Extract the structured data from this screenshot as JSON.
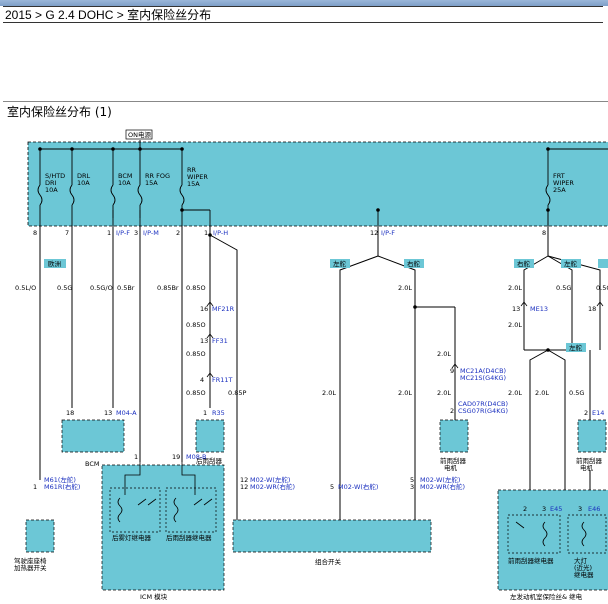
{
  "breadcrumb": "2015 > G 2.4 DOHC > 室内保险丝分布",
  "section_title": "室内保险丝分布 (1)",
  "on_label": "ON电源",
  "fuses": [
    {
      "label": "S/HTD\nDRI\n10A"
    },
    {
      "label": "DRL\n10A"
    },
    {
      "label": "BCM\n10A"
    },
    {
      "label": "RR FOG\n15A"
    },
    {
      "label": "RR\nWIPER\n15A"
    },
    {
      "label": "FRT\nWIPER\n25A"
    }
  ],
  "pins": [
    "8",
    "7",
    "1",
    "I/P-F",
    "3",
    "I/P-M",
    "2",
    "1",
    "I/P-H",
    "12",
    "I/P-F",
    "8"
  ],
  "tags": {
    "europe": "欧洲",
    "lhd": "左舵",
    "rhd": "右舵",
    "lhd2": "左舵",
    "rhd2": "右舵",
    "lhd3": "左舵",
    "lhd4": "左舵"
  },
  "wires": {
    "w1": "0.5L/O",
    "w2": "0.5G",
    "w3": "0.5G/O",
    "w4": "0.5Br",
    "w5": "0.85Br",
    "w6": "0.85O",
    "w7": "0.85O",
    "w8": "0.85O",
    "w9": "0.85O",
    "w10": "0.85P",
    "w11": "2.0L",
    "w12": "2.0L",
    "w13": "2.0L",
    "w14": "2.0L",
    "w15": "2.0L",
    "w16": "2.0L",
    "w17": "2.0L",
    "w18": "0.5G",
    "w19": "0.5G",
    "w20": "2.0L",
    "w21": "2.0L",
    "w22": "0.5G"
  },
  "connectors": {
    "mf21r": "MF21R",
    "ff31": "FF31",
    "fr11t": "FR11T",
    "me13": "ME13",
    "mc21": "MC21A(D4CB)",
    "mc21s": "MC21S(G4KG)",
    "cad07": "CAD07R(D4CB)",
    "csg07": "CSG07R(G4KG)",
    "m04a": "M04-A",
    "r35": "R35",
    "e14": "E14",
    "m08b": "M08-B",
    "m61": "M61(左舵)",
    "m61r": "M61R(右舵)",
    "m02l": "M02-W(左舵)",
    "m02r": "M02-WR(右舵)",
    "m02": "M02-W(右舵)",
    "m02l2": "M02-W(左舵)",
    "m02r2": "M02-WR(右舵)",
    "e45": "E45",
    "e46": "E46"
  },
  "pin_nums": {
    "p16": "16",
    "p13": "13",
    "p4": "4",
    "p9": "9",
    "p2": "2",
    "p18": "18",
    "p13b": "13",
    "p1": "1",
    "p1b": "1",
    "p19": "19",
    "p1c": "1",
    "p12": "12",
    "p12b": "12",
    "p5": "5",
    "p5b": "5",
    "p3": "3",
    "p3b": "3",
    "p2b": "2",
    "p3c": "3",
    "p2c": "2",
    "p13c": "13",
    "p18b": "18"
  },
  "components": {
    "bcm": "BCM",
    "rr_wiper_motor": "后雨刮器\n电机",
    "fr_wiper_motor": "前雨刮器\n电机",
    "fr_wiper_motor2": "前雨刮器\n电机",
    "seat_heater": "驾驶座座椅\n加热器开关",
    "icm": "ICM 模块",
    "rear_fog_relay": "后雾灯继电器",
    "rear_wiper_relay": "后雨刮器继电器",
    "combo_switch": "组合开关",
    "front_wiper_relay": "前雨刮器继电器",
    "headlamp_relay": "大灯\n(近光)\n继电器",
    "engine_box": "左发动机室保险丝& 继电"
  }
}
